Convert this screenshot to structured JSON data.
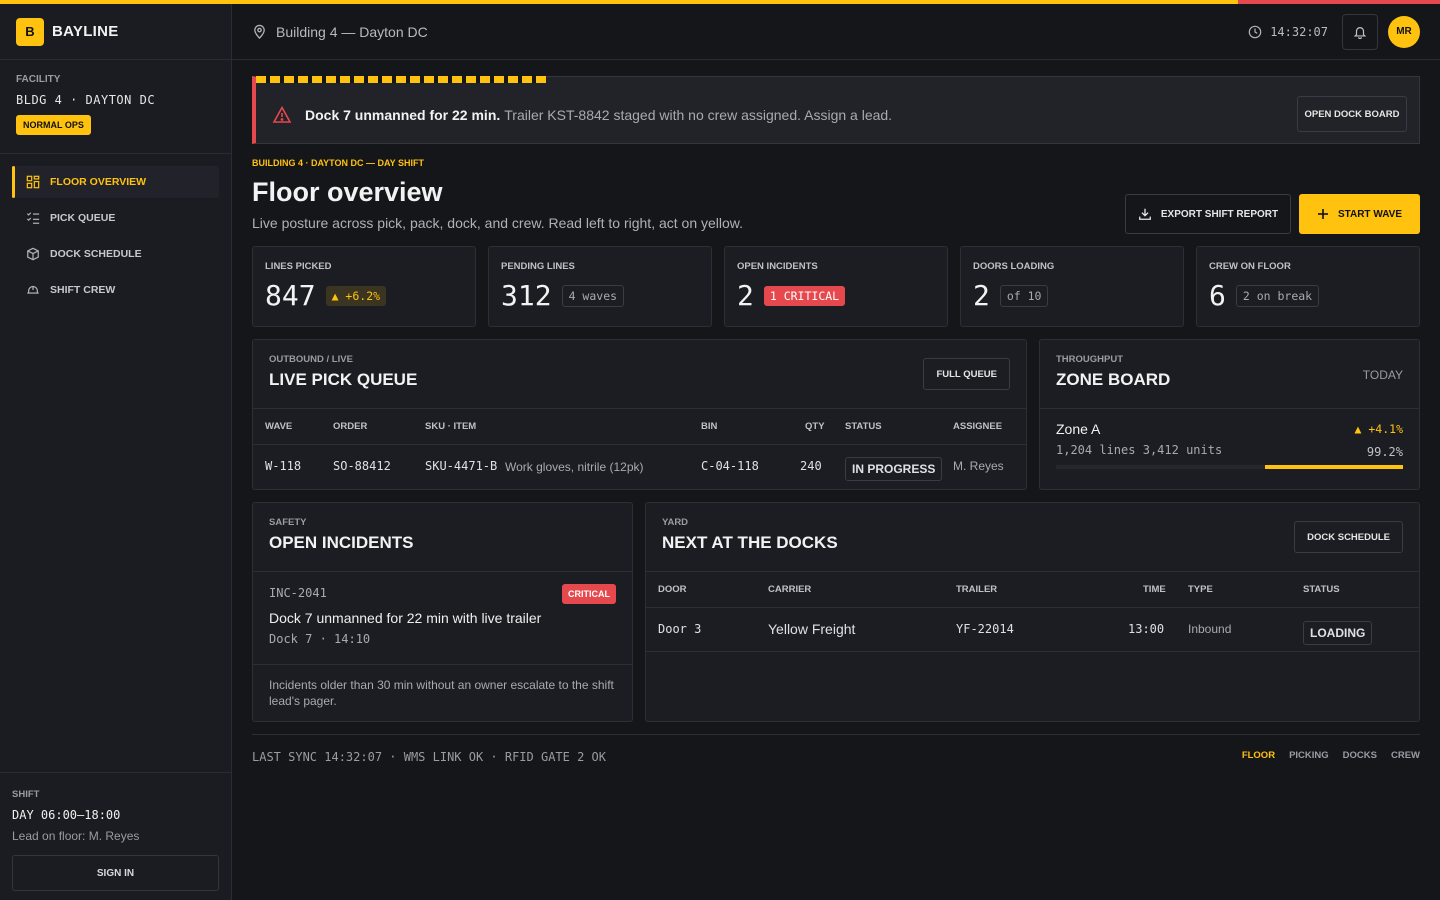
{
  "app": {
    "logo_letter": "B",
    "name": "BAYLINE"
  },
  "colors": {
    "accent": "#ffc20e",
    "danger": "#e5484d",
    "bg": "#15161a",
    "panel": "#1c1d22"
  },
  "facility": {
    "label": "FACILITY",
    "value": "BLDG 4 · DAYTON DC",
    "status": "NORMAL OPS"
  },
  "nav": [
    {
      "label": "FLOOR OVERVIEW",
      "icon": "grid-icon",
      "active": true
    },
    {
      "label": "PICK QUEUE",
      "icon": "checklist-icon",
      "active": false
    },
    {
      "label": "DOCK SCHEDULE",
      "icon": "box-icon",
      "active": false
    },
    {
      "label": "SHIFT CREW",
      "icon": "hardhat-icon",
      "active": false
    }
  ],
  "shift": {
    "label": "SHIFT",
    "time": "DAY 06:00–18:00",
    "lead": "Lead on floor: M. Reyes",
    "signin": "SIGN IN"
  },
  "topbar": {
    "location": "Building 4 — Dayton DC",
    "clock": "14:32:07",
    "avatar": "MR"
  },
  "alert": {
    "bold": "Dock 7 unmanned for 22 min.",
    "text": "Trailer KST-8842 staged with no crew assigned. Assign a lead.",
    "button": "OPEN DOCK BOARD"
  },
  "header": {
    "crumb": "BUILDING 4 · DAYTON DC — DAY SHIFT",
    "title": "Floor overview",
    "subtitle": "Live posture across pick, pack, dock, and crew. Read left to right, act on yellow.",
    "export": "EXPORT SHIFT REPORT",
    "start": "START WAVE"
  },
  "kpis": [
    {
      "label": "LINES PICKED",
      "value": "847",
      "tag": "▲ +6.2%",
      "style": "up"
    },
    {
      "label": "PENDING LINES",
      "value": "312",
      "tag": "4 waves",
      "style": "grey"
    },
    {
      "label": "OPEN INCIDENTS",
      "value": "2",
      "tag": "1 CRITICAL",
      "style": "red"
    },
    {
      "label": "DOORS LOADING",
      "value": "2",
      "tag": "of 10",
      "style": "grey"
    },
    {
      "label": "CREW ON FLOOR",
      "value": "6",
      "tag": "2 on break",
      "style": "grey"
    }
  ],
  "pick_queue": {
    "kicker": "OUTBOUND / LIVE",
    "title": "LIVE PICK QUEUE",
    "button": "FULL QUEUE",
    "columns": [
      "WAVE",
      "ORDER",
      "SKU · ITEM",
      "BIN",
      "QTY",
      "STATUS",
      "ASSIGNEE"
    ],
    "rows": [
      {
        "wave": "W-118",
        "order": "SO-88412",
        "sku": "SKU-4471-B",
        "item": "Work gloves, nitrile (12pk)",
        "bin": "C-04-118",
        "qty": "240",
        "status": "IN PROGRESS",
        "assignee": "M. Reyes"
      }
    ]
  },
  "zone_board": {
    "kicker": "THROUGHPUT",
    "title": "ZONE BOARD",
    "period": "TODAY",
    "zones": [
      {
        "name": "Zone A",
        "delta": "▲ +4.1%",
        "lines": "1,204 lines",
        "units": "3,412 units",
        "pct": "99.2%",
        "fill": 0.992
      }
    ]
  },
  "incidents": {
    "kicker": "SAFETY",
    "title": "OPEN INCIDENTS",
    "items": [
      {
        "id": "INC-2041",
        "severity": "CRITICAL",
        "desc": "Dock 7 unmanned for 22 min with live trailer",
        "meta": "Dock 7 · 14:10"
      }
    ],
    "note": "Incidents older than 30 min without an owner escalate to the shift lead's pager."
  },
  "docks": {
    "kicker": "YARD",
    "title": "NEXT AT THE DOCKS",
    "button": "DOCK SCHEDULE",
    "columns": [
      "DOOR",
      "CARRIER",
      "TRAILER",
      "TIME",
      "TYPE",
      "STATUS"
    ],
    "rows": [
      {
        "door": "Door 3",
        "carrier": "Yellow Freight",
        "trailer": "YF-22014",
        "time": "13:00",
        "type": "Inbound",
        "status": "LOADING"
      }
    ]
  },
  "footer": {
    "sync": "LAST SYNC 14:32:07 · WMS LINK OK · RFID GATE 2 OK",
    "links": [
      {
        "label": "FLOOR",
        "active": true
      },
      {
        "label": "PICKING",
        "active": false
      },
      {
        "label": "DOCKS",
        "active": false
      },
      {
        "label": "CREW",
        "active": false
      }
    ]
  }
}
